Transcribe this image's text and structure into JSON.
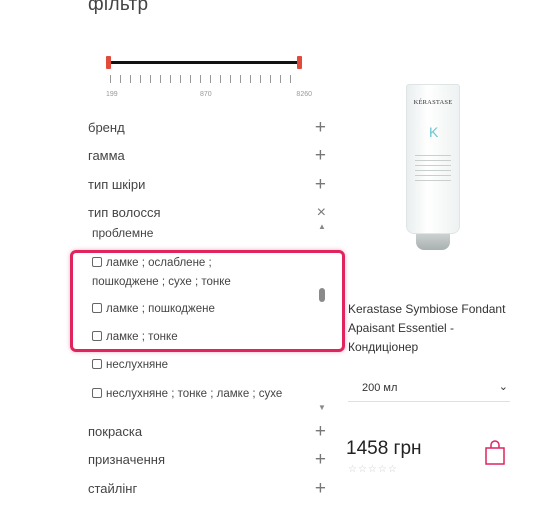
{
  "filter": {
    "heading": "фільтр",
    "price": {
      "min": "199",
      "mid": "870",
      "max": "8260"
    },
    "groups": [
      {
        "label": "бренд",
        "icon": "+"
      },
      {
        "label": "гамма",
        "icon": "+"
      },
      {
        "label": "тип шкіри",
        "icon": "+"
      },
      {
        "label": "тип волосся",
        "icon": "×"
      }
    ],
    "subgroup": "проблемне",
    "options": [
      {
        "line1": "ламке ; ослаблене ;",
        "line2": "пошкоджене ; сухе ; тонке"
      },
      {
        "line1": "ламке ; пошкоджене"
      },
      {
        "line1": "ламке ; тонке"
      },
      {
        "line1": "неслухняне"
      },
      {
        "line1": "неслухняне ; тонке ; ламке ; сухе"
      }
    ],
    "more_groups": [
      {
        "label": "покраска",
        "icon": "+"
      },
      {
        "label": "призначення",
        "icon": "+"
      },
      {
        "label": "стайлінг",
        "icon": "+"
      }
    ]
  },
  "product": {
    "brand_text": "KÉRASTASE",
    "logo_letter": "K",
    "name": "Kerastase Symbiose Fondant Apaisant Essentiel - Кондиціонер",
    "volume": "200 мл",
    "price": "1458 грн",
    "stars": "☆☆☆☆☆"
  },
  "colors": {
    "highlight": "#e0245e",
    "slider_handle": "#e24a3b",
    "bag_icon": "#e0245e"
  }
}
